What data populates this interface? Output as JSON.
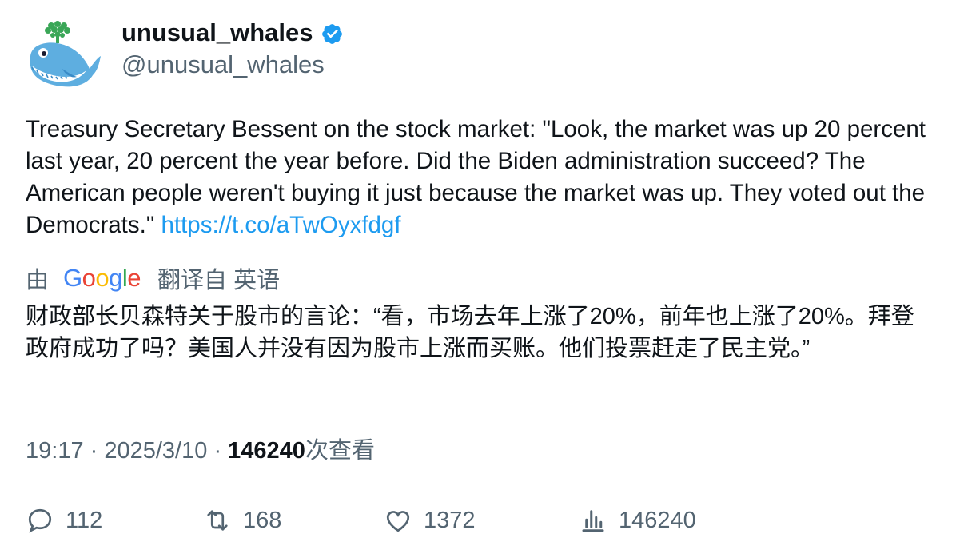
{
  "author": {
    "display_name": "unusual_whales",
    "handle": "@unusual_whales",
    "verified": true,
    "avatar_icon": "whale-logo-icon"
  },
  "tweet": {
    "text": "Treasury Secretary Bessent on the stock market: \"Look, the market was up 20 percent last year, 20 percent the year before. Did the Biden administration succeed? The American people weren't buying it just because the market was up. They voted out the Democrats.\" ",
    "link": "https://t.co/aTwOyxfdgf"
  },
  "translation": {
    "prefix": "由",
    "provider": "Google",
    "suffix": "翻译自 英语",
    "text": "财政部长贝森特关于股市的言论：“看，市场去年上涨了20%，前年也上涨了20%。拜登政府成功了吗？美国人并没有因为股市上涨而买账。他们投票赶走了民主党。”"
  },
  "meta": {
    "time": "19:17",
    "date": "2025/3/10",
    "views": "146240",
    "views_label": "次查看"
  },
  "actions": {
    "replies": "112",
    "retweets": "168",
    "likes": "1372",
    "views": "146240"
  },
  "colors": {
    "link": "#1d9bf0",
    "secondary_text": "#536471",
    "verified_badge": "#1d9bf0"
  }
}
